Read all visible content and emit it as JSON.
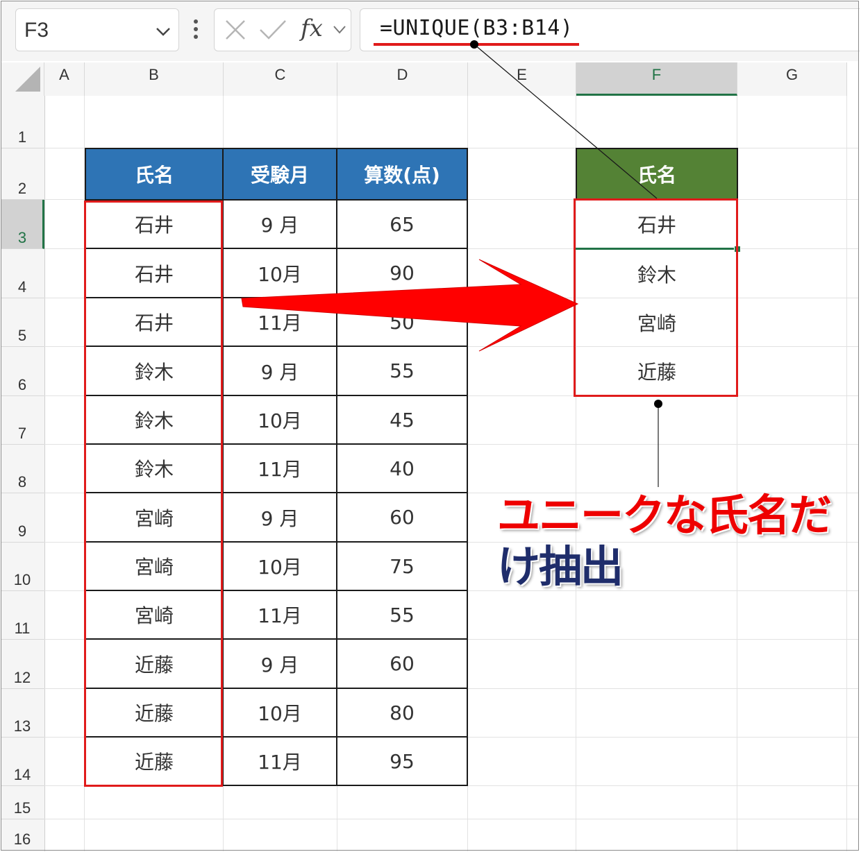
{
  "toolbar": {
    "name_box": "F3",
    "formula": "=UNIQUE(B3:B14)"
  },
  "columns": [
    "A",
    "B",
    "C",
    "D",
    "E",
    "F",
    "G"
  ],
  "rows": [
    "1",
    "2",
    "3",
    "4",
    "5",
    "6",
    "7",
    "8",
    "9",
    "10",
    "11",
    "12",
    "13",
    "14",
    "15",
    "16"
  ],
  "source_table": {
    "headers": [
      "氏名",
      "受験月",
      "算数(点)"
    ],
    "rows": [
      [
        "石井",
        "9 月",
        "65"
      ],
      [
        "石井",
        "10月",
        "90"
      ],
      [
        "石井",
        "11月",
        "50"
      ],
      [
        "鈴木",
        "9 月",
        "55"
      ],
      [
        "鈴木",
        "10月",
        "45"
      ],
      [
        "鈴木",
        "11月",
        "40"
      ],
      [
        "宮崎",
        "9 月",
        "60"
      ],
      [
        "宮崎",
        "10月",
        "75"
      ],
      [
        "宮崎",
        "11月",
        "55"
      ],
      [
        "近藤",
        "9 月",
        "60"
      ],
      [
        "近藤",
        "10月",
        "80"
      ],
      [
        "近藤",
        "11月",
        "95"
      ]
    ]
  },
  "result_table": {
    "header": "氏名",
    "values": [
      "石井",
      "鈴木",
      "宮崎",
      "近藤"
    ]
  },
  "annotation": {
    "line1": "ユニークな氏名だ",
    "line2": "け抽出"
  },
  "colors": {
    "source_header": "#2e74b5",
    "result_header": "#548235",
    "highlight": "#e01b1b",
    "excel_green": "#217346",
    "annotation_red": "#ee0000",
    "annotation_blue": "#1f2d6b"
  },
  "icons": [
    "chevron-down-icon",
    "more-vertical-icon",
    "cancel-icon",
    "check-icon",
    "fx-icon",
    "select-all-icon",
    "arrow-right-icon"
  ]
}
